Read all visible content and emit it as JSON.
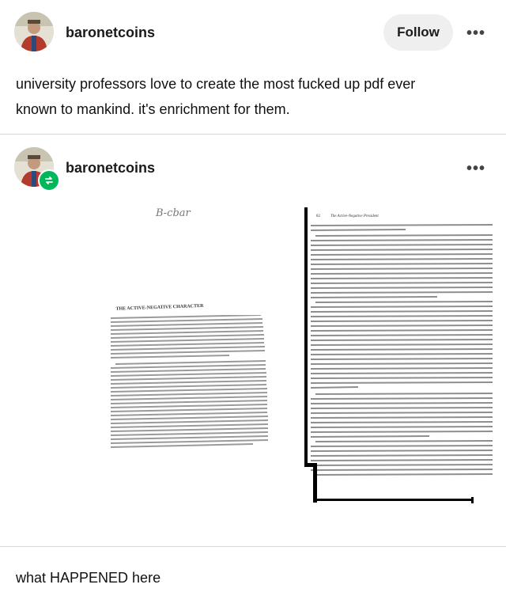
{
  "post": {
    "author": "baronetcoins",
    "follow_label": "Follow",
    "more_label": "•••",
    "text": "university professors love to create the most fucked up pdf ever known to mankind. it's enrichment for them."
  },
  "reblog": {
    "author": "baronetcoins",
    "more_label": "•••",
    "caption": "what HAPPENED here"
  },
  "scan": {
    "handwriting": "B-cbar",
    "left_heading": "THE ACTIVE-NEGATIVE CHARACTER",
    "right_page_number": "82",
    "right_running_head": "The Active-Negative President"
  },
  "colors": {
    "follow_bg": "#efefef",
    "reblog_badge": "#00b85c",
    "divider": "#d8d8d8"
  }
}
